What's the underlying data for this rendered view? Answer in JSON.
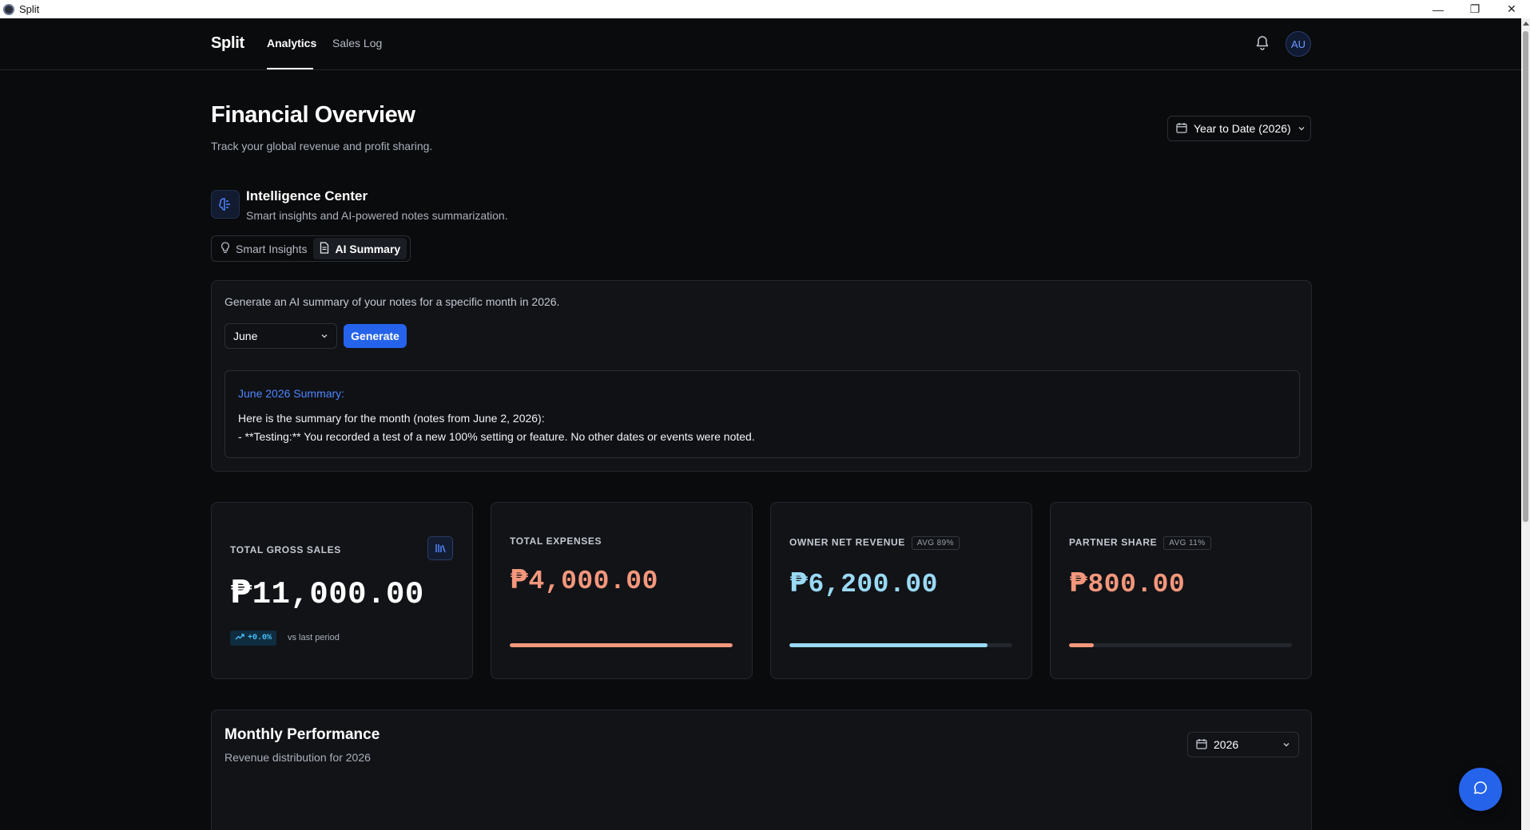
{
  "window": {
    "title": "Split",
    "minimize_glyph": "—",
    "restore_glyph": "❐",
    "close_glyph": "✕"
  },
  "nav": {
    "brand": "Split",
    "tabs": [
      {
        "label": "Analytics",
        "active": true
      },
      {
        "label": "Sales Log",
        "active": false
      }
    ],
    "avatar_initials": "AU"
  },
  "header": {
    "title": "Financial Overview",
    "subtitle": "Track your global revenue and profit sharing.",
    "date_range": "Year to Date (2026)"
  },
  "intelligence": {
    "title": "Intelligence Center",
    "subtitle": "Smart insights and AI-powered notes summarization.",
    "tabs": [
      {
        "label": "Smart Insights",
        "active": false
      },
      {
        "label": "AI Summary",
        "active": true
      }
    ]
  },
  "ai_summary": {
    "description": "Generate an AI summary of your notes for a specific month in 2026.",
    "month": "June",
    "generate_label": "Generate",
    "heading": "June 2026 Summary:",
    "lines": [
      "Here is the summary for the month (notes from June 2, 2026):",
      "- **Testing:** You recorded a test of a new 100% setting or feature. No other dates or events were noted."
    ]
  },
  "stats": {
    "currency_symbol": "₱",
    "gross": {
      "label": "TOTAL GROSS SALES",
      "value": "11,000.00",
      "trend": "+0.0%",
      "trend_text": "vs last period"
    },
    "expenses": {
      "label": "TOTAL EXPENSES",
      "value": "4,000.00",
      "progress": 1.0,
      "color": "#f4977c"
    },
    "owner": {
      "label": "OWNER NET REVENUE",
      "badge": "AVG 89%",
      "value": "6,200.00",
      "progress": 0.89,
      "color": "#9ad9f4"
    },
    "partner": {
      "label": "PARTNER SHARE",
      "badge": "AVG 11%",
      "value": "800.00",
      "progress": 0.11,
      "color": "#f4977c"
    }
  },
  "performance": {
    "title": "Monthly Performance",
    "subtitle": "Revenue distribution for 2026",
    "year": "2026"
  },
  "colors": {
    "accent": "#2563eb",
    "background": "#0a0b0d",
    "card": "#111317",
    "expenses": "#f4977c",
    "owner": "#9ad9f4"
  },
  "icons": {
    "bell": "bell-icon",
    "calendar": "calendar-icon",
    "ai": "brain-icon",
    "chart": "bar-chart-icon",
    "chat": "chat-icon",
    "lightbulb": "lightbulb-icon",
    "document": "document-icon"
  }
}
